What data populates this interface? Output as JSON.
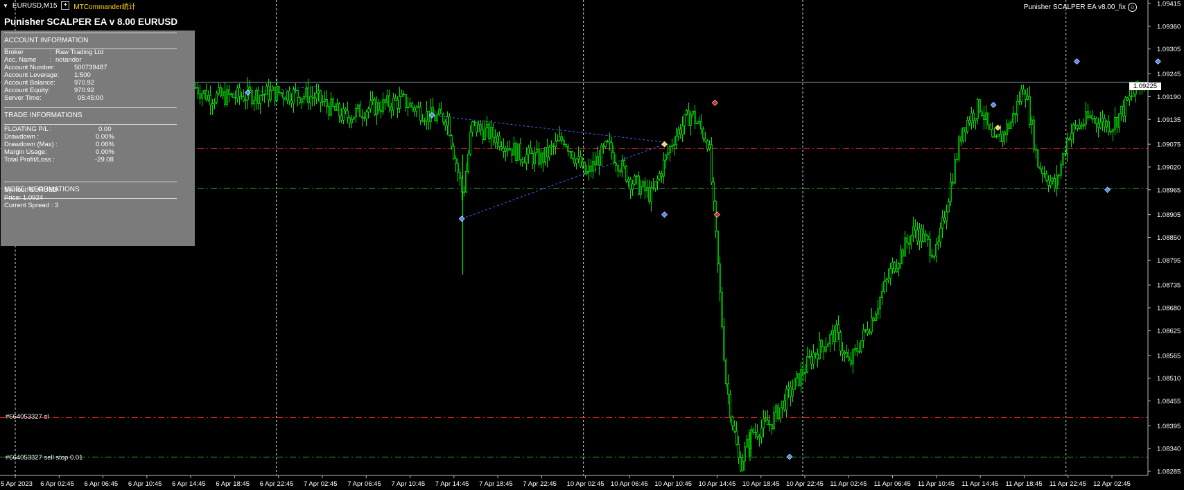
{
  "topbar": {
    "symbol_tf": "EURUSD,M15",
    "add_label": "+",
    "indicator_name": "MTCommander统计"
  },
  "ea": {
    "title": "Punisher SCALPER EA v 8.00 EURUSD",
    "right_label": "Punisher SCALPER EA v8.00_fix"
  },
  "panel": {
    "account_header": "ACCOUNT INFORMATION",
    "account_rows": [
      {
        "label": "Broker",
        "value": "Raw Trading Ltd"
      },
      {
        "label": "Acc. Name",
        "value": "notandor"
      },
      {
        "label": "Account Number:",
        "value": "500739487"
      },
      {
        "label": "Account Leverage:",
        "value": "1:500"
      },
      {
        "label": "Account Balance:",
        "value": "970.92"
      },
      {
        "label": "Account Equity:",
        "value": "970.92"
      },
      {
        "label": "Server Time:",
        "value": "05:45:00"
      }
    ],
    "trade_header": "TRADE INFORMATIONS",
    "trade_rows": [
      {
        "label": "FLOATING P/L :",
        "value": "0.00"
      },
      {
        "label": "Drawdown :",
        "value": "0.00%"
      },
      {
        "label": "Drawdown (Max) :",
        "value": "0.06%"
      },
      {
        "label": "Margin Usage:",
        "value": "0.00%"
      },
      {
        "label": "Total Profit/Loss :",
        "value": "-29.08"
      }
    ],
    "more_header": "MORE INFORMATIONS",
    "more_rows": [
      "Symbol: EURUSD",
      "Price:  1.0924",
      "Current Spread  :  3"
    ]
  },
  "orders": {
    "sl_label": "#664053327 sl",
    "stop_label": "#664053327 sell stop 0.01"
  },
  "current_price": "1.09225",
  "chart_data": {
    "type": "candlestick",
    "symbol": "EURUSD",
    "timeframe": "M15",
    "y_ticks": [
      "1.09415",
      "1.09360",
      "1.09305",
      "1.09245",
      "1.09190",
      "1.09135",
      "1.09075",
      "1.09020",
      "1.08965",
      "1.08905",
      "1.08850",
      "1.08795",
      "1.08735",
      "1.08680",
      "1.08625",
      "1.08565",
      "1.08510",
      "1.08455",
      "1.08395",
      "1.08340",
      "1.08285"
    ],
    "x_ticks": [
      "5 Apr 2023",
      "6 Apr 02:45",
      "6 Apr 06:45",
      "6 Apr 10:45",
      "6 Apr 14:45",
      "6 Apr 18:45",
      "6 Apr 22:45",
      "7 Apr 02:45",
      "7 Apr 06:45",
      "7 Apr 10:45",
      "7 Apr 14:45",
      "7 Apr 18:45",
      "7 Apr 22:45",
      "10 Apr 02:45",
      "10 Apr 06:45",
      "10 Apr 10:45",
      "10 Apr 14:45",
      "10 Apr 18:45",
      "10 Apr 22:45",
      "11 Apr 02:45",
      "11 Apr 06:45",
      "11 Apr 10:45",
      "11 Apr 14:45",
      "11 Apr 18:45",
      "11 Apr 22:45",
      "12 Apr 02:45"
    ],
    "ylim": [
      1.08275,
      1.0942
    ],
    "price_path": [
      [
        0,
        1.0889
      ],
      [
        0.5,
        1.0898
      ],
      [
        1.5,
        1.092
      ],
      [
        2.5,
        1.0937
      ],
      [
        3.2,
        1.0931
      ],
      [
        4,
        1.0922
      ],
      [
        4.4,
        1.0919
      ],
      [
        5,
        1.0919
      ],
      [
        6,
        1.092
      ],
      [
        6.8,
        1.0919
      ],
      [
        7.5,
        1.0914
      ],
      [
        8,
        1.0916
      ],
      [
        8.8,
        1.0918
      ],
      [
        9.5,
        1.0914
      ],
      [
        9.85,
        1.0914
      ],
      [
        10,
        1.0905
      ],
      [
        10.2,
        1.0895
      ],
      [
        10.4,
        1.0912
      ],
      [
        11,
        1.0909
      ],
      [
        11.5,
        1.0905
      ],
      [
        12,
        1.0904
      ],
      [
        12.5,
        1.0909
      ],
      [
        13,
        1.09
      ],
      [
        13.5,
        1.0907
      ],
      [
        14,
        1.0899
      ],
      [
        14.5,
        1.0895
      ],
      [
        15,
        1.0909
      ],
      [
        15.4,
        1.0915
      ],
      [
        15.8,
        1.0908
      ],
      [
        16.2,
        1.085
      ],
      [
        16.5,
        1.083
      ],
      [
        16.8,
        1.0838
      ],
      [
        17.2,
        1.084
      ],
      [
        17.8,
        1.085
      ],
      [
        18.2,
        1.0857
      ],
      [
        18.7,
        1.0862
      ],
      [
        19,
        1.0854
      ],
      [
        19.5,
        1.0865
      ],
      [
        20,
        1.0878
      ],
      [
        20.5,
        1.0887
      ],
      [
        21,
        1.0881
      ],
      [
        21.3,
        1.0897
      ],
      [
        21.6,
        1.0912
      ],
      [
        22,
        1.0917
      ],
      [
        22.3,
        1.0907
      ],
      [
        22.7,
        1.0913
      ],
      [
        23,
        1.0922
      ],
      [
        23.3,
        1.0903
      ],
      [
        23.7,
        1.0897
      ],
      [
        24,
        1.091
      ],
      [
        24.5,
        1.0914
      ],
      [
        25,
        1.0912
      ],
      [
        25.5,
        1.092
      ],
      [
        25.9,
        1.0924
      ]
    ],
    "horizontal_lines": [
      {
        "kind": "current",
        "price": 1.09225,
        "color": "#8fa3b8"
      },
      {
        "kind": "sell",
        "price": 1.09065,
        "color": "#e02020"
      },
      {
        "kind": "buy",
        "price": 1.0897,
        "color": "#28b428"
      },
      {
        "kind": "sl",
        "price": 1.08415,
        "color": "#e02020"
      },
      {
        "kind": "sell-stop",
        "price": 1.0832,
        "color": "#28b428"
      }
    ],
    "day_separators": [
      "6 Apr 22:45",
      "10 Apr 02:45",
      "10 Apr 22:45",
      "11 Apr 22:45"
    ],
    "trade_markers": [
      {
        "x": 5.3,
        "price": 1.092,
        "color": "#4a8cff"
      },
      {
        "x": 9.5,
        "price": 1.09145,
        "color": "#4a8cff"
      },
      {
        "x": 10.18,
        "price": 1.08895,
        "color": "#4a8cff"
      },
      {
        "x": 14.8,
        "price": 1.09075,
        "color": "#ffd060"
      },
      {
        "x": 15.95,
        "price": 1.09175,
        "color": "#e02020"
      },
      {
        "x": 16.0,
        "price": 1.08905,
        "color": "#e02020"
      },
      {
        "x": 14.8,
        "price": 1.08905,
        "color": "#4a8cff"
      },
      {
        "x": 17.65,
        "price": 1.0832,
        "color": "#4a8cff"
      },
      {
        "x": 22.3,
        "price": 1.0917,
        "color": "#4a8cff"
      },
      {
        "x": 22.4,
        "price": 1.09115,
        "color": "#ffd060"
      },
      {
        "x": 24.2,
        "price": 1.09275,
        "color": "#4a8cff"
      },
      {
        "x": 24.9,
        "price": 1.08965,
        "color": "#4a8cff"
      },
      {
        "x": 26.05,
        "price": 1.09275,
        "color": "#4a8cff"
      }
    ],
    "trade_lines": [
      {
        "x1": 5.3,
        "p1": 1.092,
        "x2": 6.9,
        "p2": 1.09215
      },
      {
        "x1": 9.5,
        "p1": 1.09145,
        "x2": 14.8,
        "p2": 1.0908
      },
      {
        "x1": 10.18,
        "p1": 1.08895,
        "x2": 14.8,
        "p2": 1.09075
      }
    ]
  }
}
